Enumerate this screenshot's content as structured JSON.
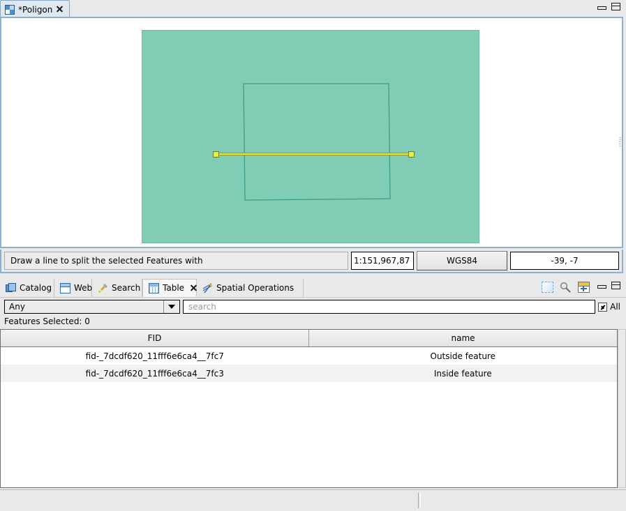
{
  "editor": {
    "tab": {
      "label": "*Poligon",
      "icon": "map-layer-icon",
      "close": "close-icon"
    },
    "window_controls": {
      "minimize": "minimize-icon",
      "maximize": "maximize-icon"
    },
    "map": {
      "outer_feature_name": "Outside feature",
      "inner_feature_name": "Inside feature",
      "fill_color": "#81ccb5",
      "outline_color": "#3f9c82",
      "split_line_color": "#e7e73c",
      "vertex_color": "#ece94a",
      "vertex_border_color": "#6e7a2a"
    },
    "status": {
      "message": "Draw a line to split the selected Features with",
      "scale": "1:151,967,87",
      "crs": "WGS84",
      "coordinates": "-39, -7"
    }
  },
  "bottom_panel": {
    "tabs": [
      {
        "label": "Catalog",
        "icon": "catalog-icon",
        "selected": false
      },
      {
        "label": "Web",
        "icon": "web-browser-icon",
        "selected": false
      },
      {
        "label": "Search",
        "icon": "search-pencil-icon",
        "selected": false
      },
      {
        "label": "Table",
        "icon": "table-icon",
        "selected": true
      },
      {
        "label": "Spatial Operations",
        "icon": "spatial-operations-icon",
        "selected": false
      }
    ],
    "toolbar": [
      {
        "name": "select-all-icon"
      },
      {
        "name": "zoom-to-selection-icon"
      },
      {
        "name": "add-column-icon"
      }
    ],
    "window_controls": {
      "minimize": "minimize-icon",
      "maximize": "maximize-icon"
    },
    "filter": {
      "field_selector_value": "Any",
      "search_placeholder": "search",
      "search_value": "",
      "all_label": "All",
      "all_checked": true
    },
    "features_selected": "Features Selected: 0",
    "table": {
      "columns": [
        "FID",
        "name"
      ],
      "rows": [
        [
          "fid-_7dcdf620_11fff6e6ca4__7fc7",
          "Outside feature"
        ],
        [
          "fid-_7dcdf620_11fff6e6ca4__7fc3",
          "Inside feature"
        ]
      ]
    }
  }
}
